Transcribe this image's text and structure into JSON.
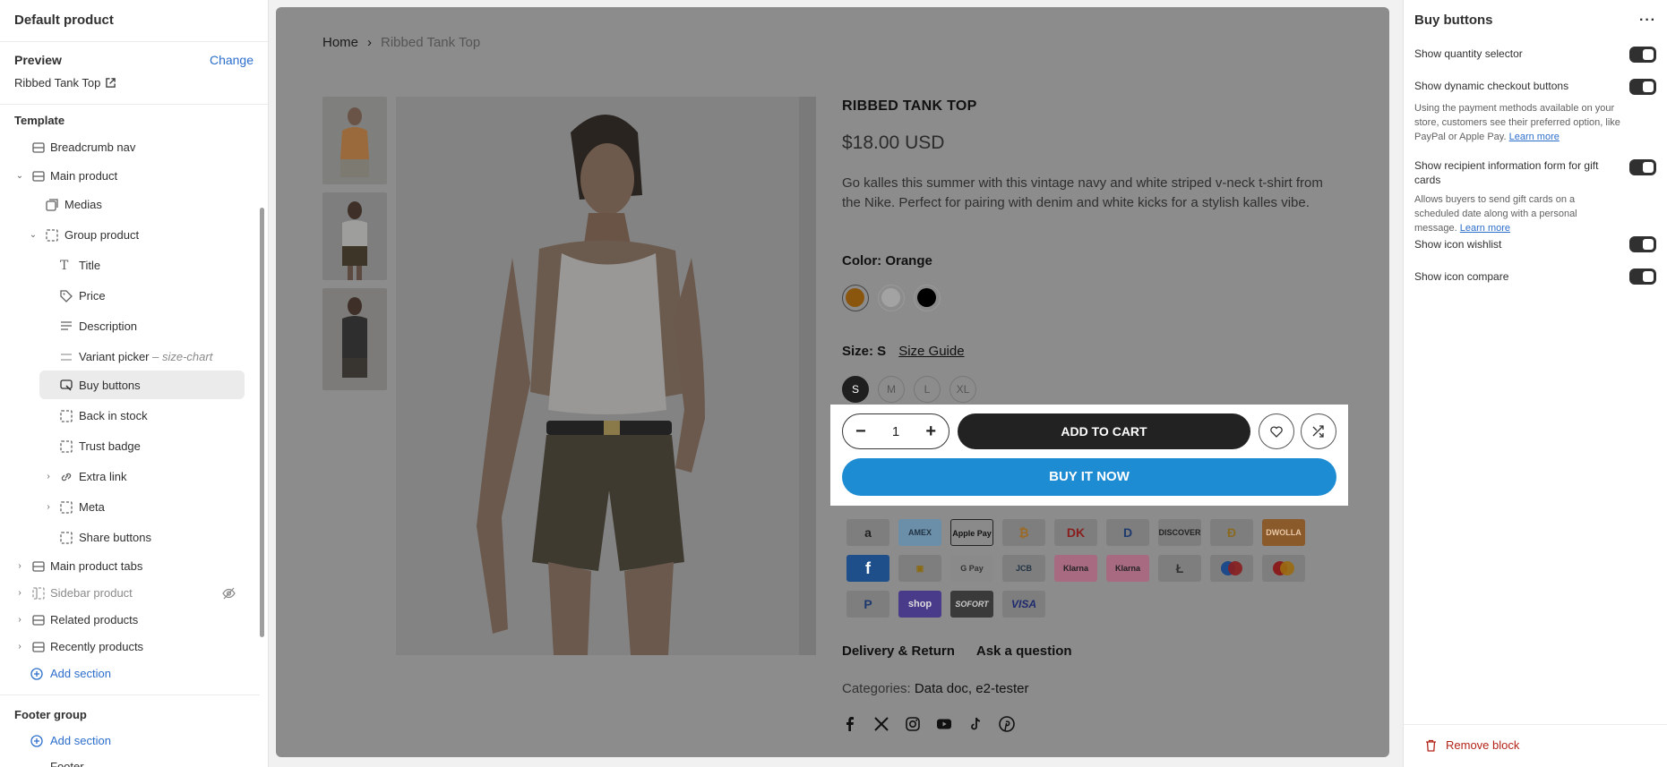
{
  "left": {
    "header": "Default product",
    "preview_label": "Preview",
    "change_link": "Change",
    "preview_product": "Ribbed Tank Top",
    "template_label": "Template",
    "tree": {
      "breadcrumb": "Breadcrumb nav",
      "main_product": "Main product",
      "medias": "Medias",
      "group_product": "Group product",
      "title": "Title",
      "price": "Price",
      "description": "Description",
      "variant_picker": "Variant picker",
      "variant_picker_suffix": "– size-chart",
      "buy_buttons": "Buy buttons",
      "back_in_stock": "Back in stock",
      "trust_badge": "Trust badge",
      "extra_link": "Extra link",
      "meta": "Meta",
      "share_buttons": "Share buttons",
      "main_product_tabs": "Main product tabs",
      "sidebar_product": "Sidebar product",
      "related_products": "Related products",
      "recently_products": "Recently products",
      "add_section": "Add section"
    },
    "footer_group": "Footer group",
    "footer_add_section": "Add section",
    "footer_cut": "Footer"
  },
  "center": {
    "breadcrumb": {
      "home": "Home",
      "current": "Ribbed Tank Top"
    },
    "product_title": "RIBBED TANK TOP",
    "price": "$18.00 USD",
    "description": "Go kalles this summer with this vintage navy and white striped v-neck t-shirt from the Nike. Perfect for pairing with denim and white kicks for a stylish kalles vibe.",
    "color_label": "Color: Orange",
    "colors": [
      "#c47a14",
      "#e8e8e8",
      "#000000"
    ],
    "size_label": "Size: S",
    "size_guide": "Size Guide",
    "sizes": [
      "S",
      "M",
      "L",
      "XL"
    ],
    "quantity": "1",
    "add_to_cart": "ADD TO CART",
    "buy_it_now": "BUY IT NOW",
    "payments": [
      "amazon",
      "AMEX",
      "Apple Pay",
      "bitcoin",
      "Dankort",
      "diners",
      "DISCOVER",
      "dogecoin",
      "DWOLLA",
      "forbrugsforeningen",
      "interac",
      "G Pay",
      "JCB",
      "Klarna",
      "Klarna",
      "litecoin",
      "maestro",
      "mastercard",
      "PayPal",
      "shop",
      "SOFORT",
      "VISA"
    ],
    "tab_delivery": "Delivery & Return",
    "tab_ask": "Ask a question",
    "categories_label": "Categories:",
    "categories_value": "Data doc, e2-tester"
  },
  "right": {
    "title": "Buy buttons",
    "show_quantity": "Show quantity selector",
    "show_dynamic": "Show dynamic checkout buttons",
    "dynamic_help": "Using the payment methods available on your store, customers see their preferred option, like PayPal or Apple Pay.",
    "learn_more": "Learn more",
    "show_recipient": "Show recipient information form for gift cards",
    "recipient_help": "Allows buyers to send gift cards on a scheduled date along with a personal message.",
    "show_wishlist": "Show icon wishlist",
    "show_compare": "Show icon compare",
    "remove_block": "Remove block"
  }
}
